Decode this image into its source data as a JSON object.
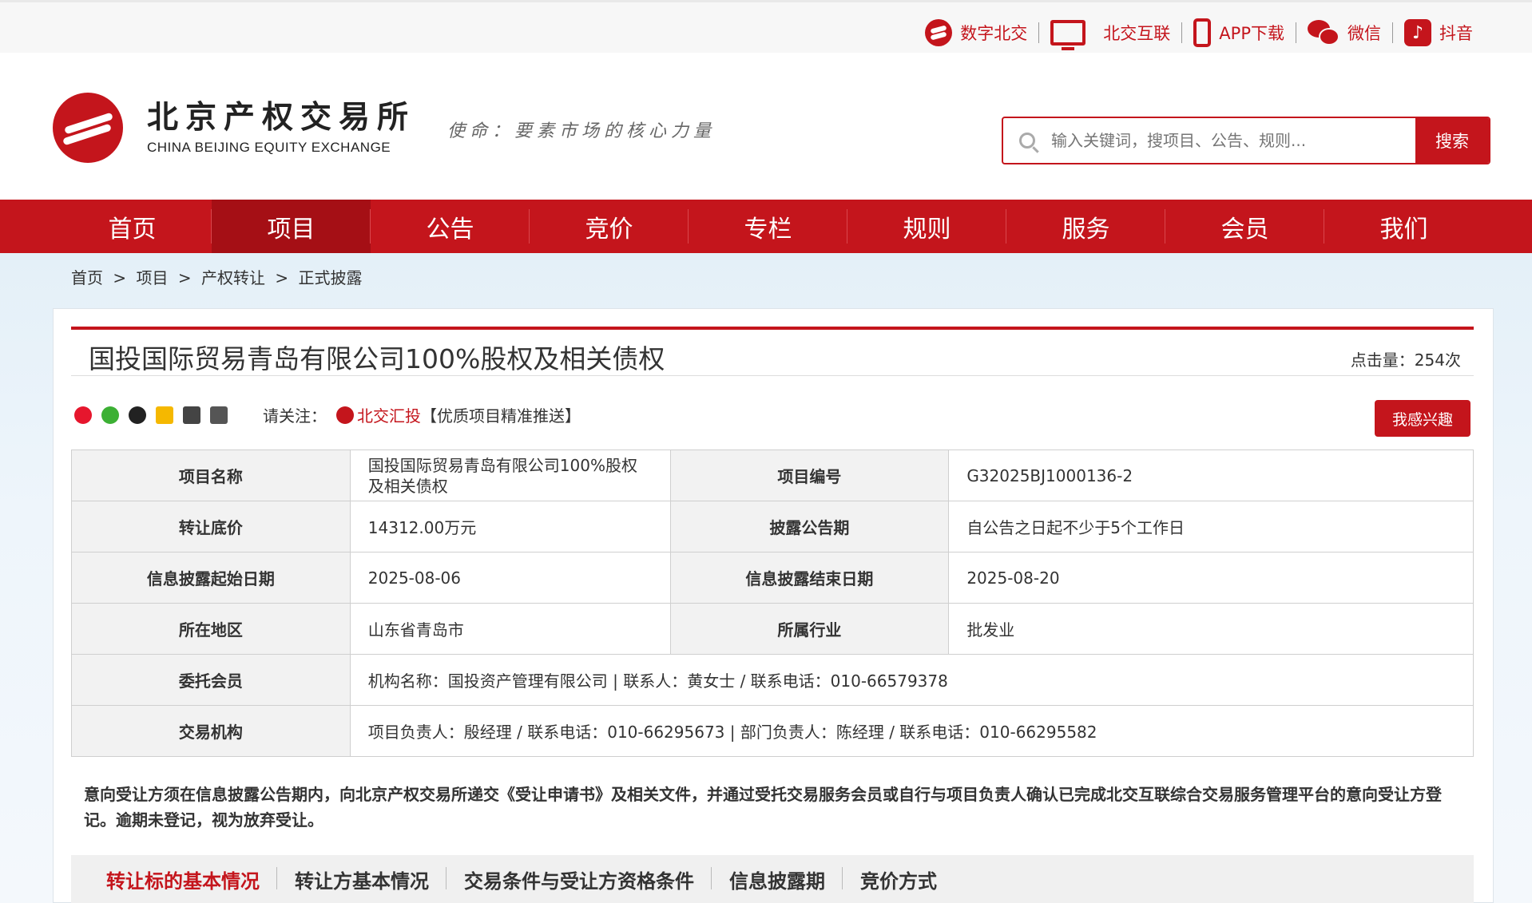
{
  "topbar": {
    "links": [
      {
        "label": "数字北交",
        "icon": "digital-beijiao-icon"
      },
      {
        "label": "北交互联",
        "icon": "monitor-icon"
      },
      {
        "label": "APP下载",
        "icon": "phone-icon"
      },
      {
        "label": "微信",
        "icon": "wechat-icon"
      },
      {
        "label": "抖音",
        "icon": "douyin-icon"
      }
    ]
  },
  "header": {
    "logo_cn": "北京产权交易所",
    "logo_en": "CHINA BEIJING EQUITY EXCHANGE",
    "mission": "使命：要素市场的核心力量",
    "search_placeholder": "输入关键词，搜项目、公告、规则...",
    "search_button": "搜索"
  },
  "nav": {
    "items": [
      "首页",
      "项目",
      "公告",
      "竞价",
      "专栏",
      "规则",
      "服务",
      "会员",
      "我们"
    ],
    "active": "项目"
  },
  "breadcrumb": [
    "首页",
    ">",
    "项目",
    ">",
    "产权转让",
    ">",
    "正式披露"
  ],
  "project": {
    "title": "国投国际贸易青岛有限公司100%股权及相关债权",
    "clicks": "点击量：254次",
    "follow_label": "请关注：",
    "follow_brand": "北交汇投",
    "follow_tagline": "【优质项目精准推送】",
    "interest_button": "我感兴趣"
  },
  "table": {
    "rows": [
      {
        "l1": "项目名称",
        "v1": "国投国际贸易青岛有限公司100%股权及相关债权",
        "l2": "项目编号",
        "v2": "G32025BJ1000136-2"
      },
      {
        "l1": "转让底价",
        "v1": "14312.00万元",
        "l2": "披露公告期",
        "v2": "自公告之日起不少于5个工作日"
      },
      {
        "l1": "信息披露起始日期",
        "v1": "2025-08-06",
        "l2": "信息披露结束日期",
        "v2": "2025-08-20"
      },
      {
        "l1": "所在地区",
        "v1": "山东省青岛市",
        "l2": "所属行业",
        "v2": "批发业"
      }
    ],
    "member_label": "委托会员",
    "member_value": "机构名称：国投资产管理有限公司 | 联系人：黄女士 / 联系电话：010-66579378",
    "agency_label": "交易机构",
    "agency_value": "项目负责人：殷经理 / 联系电话：010-66295673 | 部门负责人：陈经理 / 联系电话：010-66295582"
  },
  "notice": "意向受让方须在信息披露公告期内，向北京产权交易所递交《受让申请书》及相关文件，并通过受托交易服务会员或自行与项目负责人确认已完成北交互联综合交易服务管理平台的意向受让方登记。逾期未登记，视为放弃受让。",
  "tabs": [
    "转让标的基本情况",
    "转让方基本情况",
    "交易条件与受让方资格条件",
    "信息披露期",
    "竞价方式"
  ],
  "colors": {
    "brand_red": "#c4151c",
    "nav_active": "#a50f15"
  }
}
